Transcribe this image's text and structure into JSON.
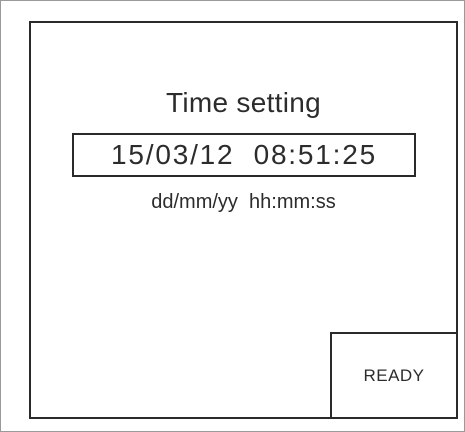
{
  "screen": {
    "title": "Time setting",
    "datetime_value": "15/03/12  08:51:25",
    "format_hint": "dd/mm/yy  hh:mm:ss",
    "ready_label": "READY"
  }
}
